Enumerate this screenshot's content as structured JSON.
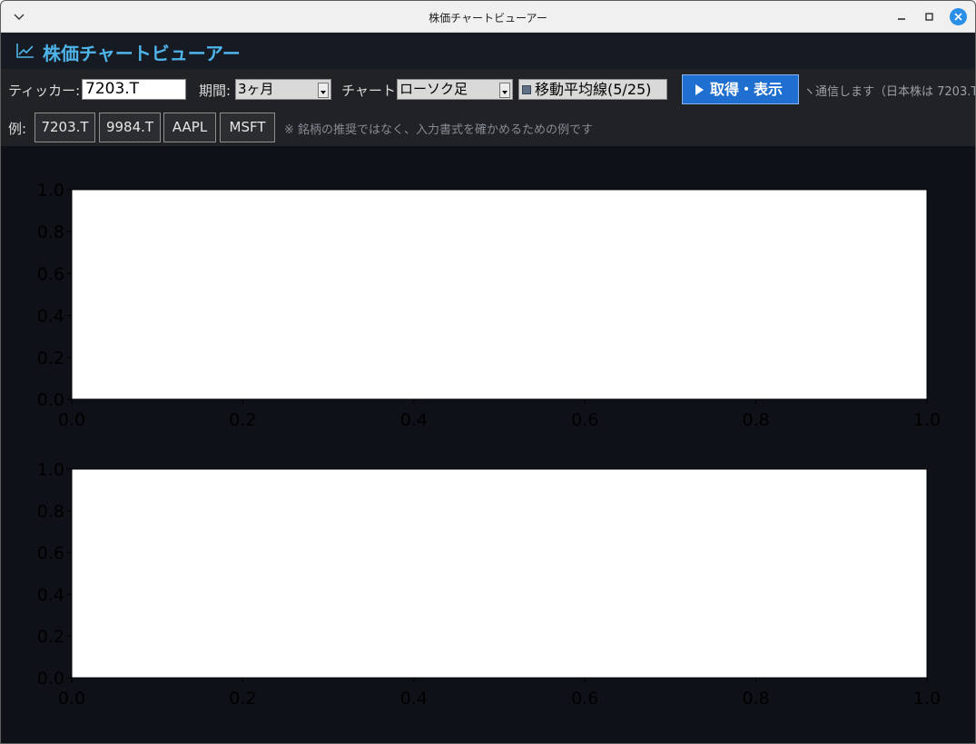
{
  "window": {
    "title": "株価チャートビューアー",
    "menu_icon": "chevron-down-icon",
    "controls": [
      "minimize-icon",
      "maximize-icon",
      "close-icon"
    ]
  },
  "header": {
    "icon": "line-chart-icon",
    "title": "株価チャートビューアー",
    "accent_color": "#4fb4ea"
  },
  "toolbar": {
    "ticker_label": "ティッカー:",
    "ticker_value": "7203.T",
    "period_label": "期間:",
    "period_value": "3ヶ月",
    "chart_label": "チャート:",
    "chart_type_value": "ローソク足",
    "ma_checkbox_label": "移動平均線(5/25)",
    "ma_checked": true,
    "fetch_button_label": "取得・表示",
    "fetch_button_color": "#1f6fd0",
    "note": "ヽ通信します（日本株は 7203.T"
  },
  "examples": {
    "label": "例:",
    "tickers": [
      "7203.T",
      "9984.T",
      "AAPL",
      "MSFT"
    ],
    "hint": "※ 銘柄の推奨ではなく、入力書式を確かめるための例です"
  },
  "chart_data": [
    {
      "type": "line",
      "series": [],
      "xlim": [
        0.0,
        1.0
      ],
      "ylim": [
        0.0,
        1.0
      ],
      "xticks": [
        "0.0",
        "0.2",
        "0.4",
        "0.6",
        "0.8",
        "1.0"
      ],
      "yticks": [
        "0.0",
        "0.2",
        "0.4",
        "0.6",
        "0.8",
        "1.0"
      ],
      "grid": false
    },
    {
      "type": "line",
      "series": [],
      "xlim": [
        0.0,
        1.0
      ],
      "ylim": [
        0.0,
        1.0
      ],
      "xticks": [
        "0.0",
        "0.2",
        "0.4",
        "0.6",
        "0.8",
        "1.0"
      ],
      "yticks": [
        "0.0",
        "0.2",
        "0.4",
        "0.6",
        "0.8",
        "1.0"
      ],
      "grid": false
    }
  ]
}
